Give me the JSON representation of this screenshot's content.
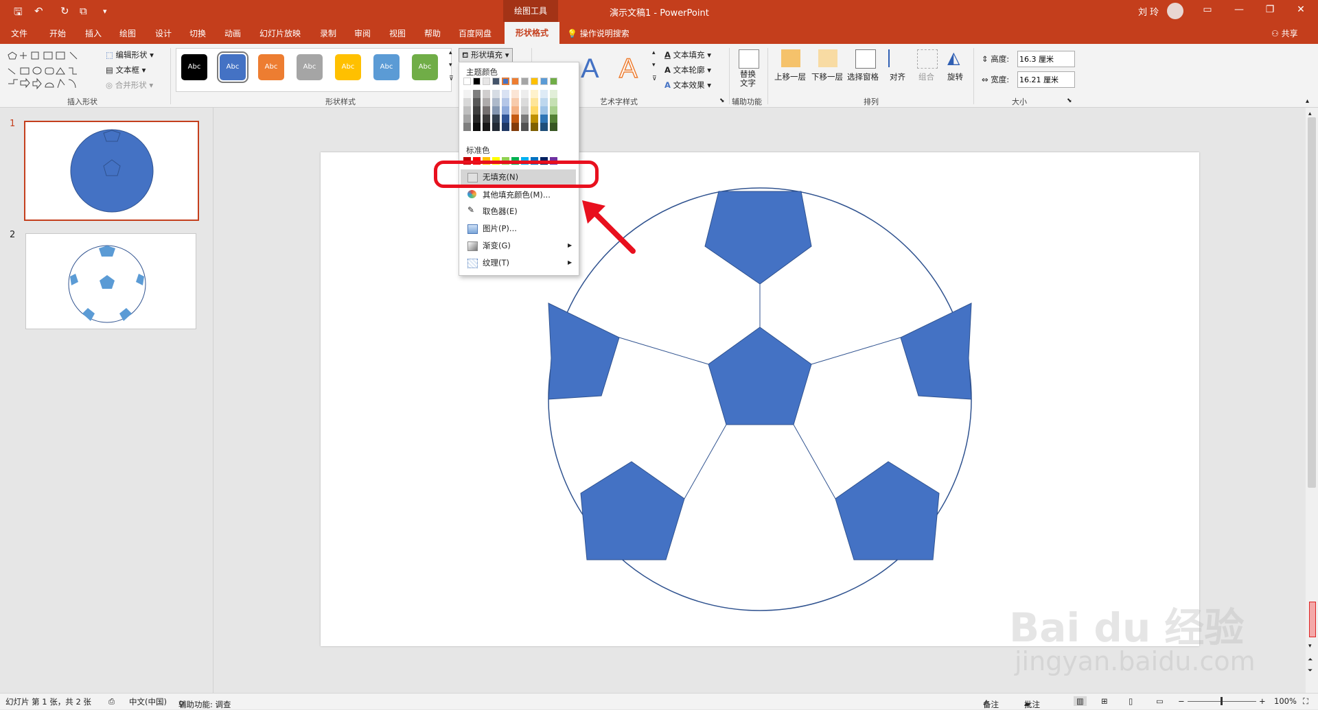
{
  "titlebar": {
    "context_tools": "绘图工具",
    "doc_title": "演示文稿1  -  PowerPoint",
    "user": "刘 玲"
  },
  "tabs": [
    "文件",
    "开始",
    "插入",
    "绘图",
    "设计",
    "切换",
    "动画",
    "幻灯片放映",
    "录制",
    "审阅",
    "视图",
    "帮助",
    "百度网盘"
  ],
  "active_tab": "形状格式",
  "tell_me": "操作说明搜索",
  "share": "共享",
  "ribbon": {
    "insert_shapes": {
      "label": "插入形状",
      "edit_shape": "编辑形状",
      "text_box": "文本框",
      "merge_shapes": "合并形状"
    },
    "shape_styles": {
      "label": "形状样式",
      "style_text": "Abc",
      "fill_button": "形状填充",
      "colors": [
        "#000000",
        "#4472c4",
        "#ed7d31",
        "#a5a5a5",
        "#ffc000",
        "#5b9bd5",
        "#70ad47"
      ]
    },
    "wordart": {
      "label": "艺术字样式",
      "text_fill": "文本填充",
      "text_outline": "文本轮廓",
      "text_effect": "文本效果"
    },
    "accessibility": {
      "label": "辅助功能",
      "alt_text": "替换文字"
    },
    "arrange": {
      "label": "排列",
      "bring_forward": "上移一层",
      "send_backward": "下移一层",
      "selection_pane": "选择窗格",
      "align": "对齐",
      "group": "组合",
      "rotate": "旋转"
    },
    "size": {
      "label": "大小",
      "height_label": "高度:",
      "height_value": "16.3 厘米",
      "width_label": "宽度:",
      "width_value": "16.21 厘米"
    }
  },
  "dropdown": {
    "theme_colors": "主题颜色",
    "standard_colors": "标准色",
    "items": {
      "no_fill": "无填充(N)",
      "more_colors": "其他填充颜色(M)...",
      "eyedropper": "取色器(E)",
      "picture": "图片(P)...",
      "gradient": "渐变(G)",
      "texture": "纹理(T)"
    }
  },
  "thumbnails": {
    "slide1": "1",
    "slide2": "2"
  },
  "statusbar": {
    "slide_info": "幻灯片 第 1 张，共 2 张",
    "language": "中文(中国)",
    "accessibility": "辅助功能: 调查",
    "notes": "备注",
    "comments": "批注",
    "zoom": "100%"
  },
  "watermark": {
    "line1": "Bai du 经验",
    "line2": "jingyan.baidu.com"
  },
  "colors": {
    "accent": "#c43e1c",
    "ball_blue": "#4472c4",
    "highlight": "#e8101e"
  }
}
